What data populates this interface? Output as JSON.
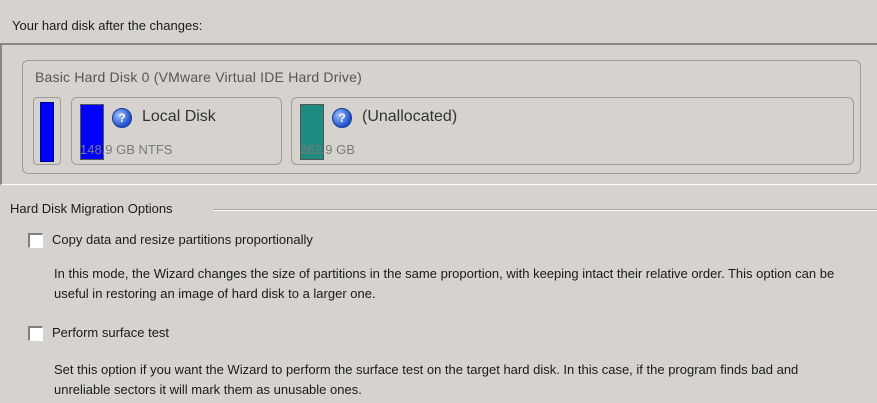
{
  "header": {
    "label": "Your hard disk after the changes:"
  },
  "disk": {
    "title": "Basic Hard Disk 0 (VMware Virtual IDE Hard Drive)",
    "partitions": [
      {
        "name": "Local Disk",
        "size": "148.9 GB NTFS",
        "color": "#0000ff"
      },
      {
        "name": "(Unallocated)",
        "size": "362.9 GB",
        "color": "#1f8a80"
      }
    ]
  },
  "options": {
    "section_title": "Hard Disk Migration Options",
    "items": [
      {
        "label": "Copy data and resize partitions proportionally",
        "checked": false,
        "description": "In this mode, the Wizard changes the size of partitions in the same proportion, with keeping intact their relative order. This option can be useful in restoring an image of hard disk to a larger one."
      },
      {
        "label": "Perform surface test",
        "checked": false,
        "description": "Set this option if you want the Wizard to perform the surface test on the target hard disk. In this case, if the program finds bad and unreliable sectors it will mark them as unusable ones."
      }
    ]
  }
}
